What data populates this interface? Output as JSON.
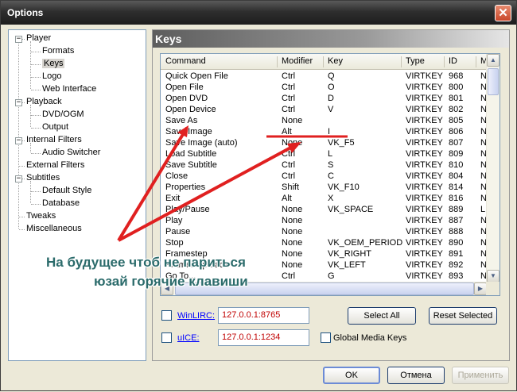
{
  "window": {
    "title": "Options",
    "close_glyph": "✕"
  },
  "tree": {
    "items": [
      {
        "label": "Player",
        "expander": "−"
      },
      {
        "label": "Formats"
      },
      {
        "label": "Keys",
        "selected": true
      },
      {
        "label": "Logo"
      },
      {
        "label": "Web Interface"
      },
      {
        "label": "Playback",
        "expander": "−"
      },
      {
        "label": "DVD/OGM"
      },
      {
        "label": "Output"
      },
      {
        "label": "Internal Filters",
        "expander": "−"
      },
      {
        "label": "Audio Switcher"
      },
      {
        "label": "External Filters"
      },
      {
        "label": "Subtitles",
        "expander": "−"
      },
      {
        "label": "Default Style"
      },
      {
        "label": "Database"
      },
      {
        "label": "Tweaks"
      },
      {
        "label": "Miscellaneous"
      }
    ]
  },
  "panel": {
    "title": "Keys"
  },
  "table": {
    "columns": [
      "Command",
      "Modifier",
      "Key",
      "Type",
      "ID",
      "M"
    ],
    "rows": [
      [
        "Quick Open File",
        "Ctrl",
        "Q",
        "VIRTKEY",
        "968",
        "N"
      ],
      [
        "Open File",
        "Ctrl",
        "O",
        "VIRTKEY",
        "800",
        "N"
      ],
      [
        "Open DVD",
        "Ctrl",
        "D",
        "VIRTKEY",
        "801",
        "N"
      ],
      [
        "Open Device",
        "Ctrl",
        "V",
        "VIRTKEY",
        "802",
        "N"
      ],
      [
        "Save As",
        "None",
        "",
        "VIRTKEY",
        "805",
        "N"
      ],
      [
        "Save Image",
        "Alt",
        "I",
        "VIRTKEY",
        "806",
        "N"
      ],
      [
        "Save Image (auto)",
        "None",
        "VK_F5",
        "VIRTKEY",
        "807",
        "N"
      ],
      [
        "Load Subtitle",
        "Ctrl",
        "L",
        "VIRTKEY",
        "809",
        "N"
      ],
      [
        "Save Subtitle",
        "Ctrl",
        "S",
        "VIRTKEY",
        "810",
        "N"
      ],
      [
        "Close",
        "Ctrl",
        "C",
        "VIRTKEY",
        "804",
        "N"
      ],
      [
        "Properties",
        "Shift",
        "VK_F10",
        "VIRTKEY",
        "814",
        "N"
      ],
      [
        "Exit",
        "Alt",
        "X",
        "VIRTKEY",
        "816",
        "N"
      ],
      [
        "Play/Pause",
        "None",
        "VK_SPACE",
        "VIRTKEY",
        "889",
        "L"
      ],
      [
        "Play",
        "None",
        "",
        "VIRTKEY",
        "887",
        "N"
      ],
      [
        "Pause",
        "None",
        "",
        "VIRTKEY",
        "888",
        "N"
      ],
      [
        "Stop",
        "None",
        "VK_OEM_PERIOD",
        "VIRTKEY",
        "890",
        "N"
      ],
      [
        "Framestep",
        "None",
        "VK_RIGHT",
        "VIRTKEY",
        "891",
        "N"
      ],
      [
        "Framestep back",
        "None",
        "VK_LEFT",
        "VIRTKEY",
        "892",
        "N"
      ],
      [
        "Go To...",
        "Ctrl",
        "G",
        "VIRTKEY",
        "893",
        "N"
      ]
    ]
  },
  "winlirc": {
    "label": "WinLIRC:",
    "value": "127.0.0.1:8765"
  },
  "uice": {
    "label": "uICE:",
    "value": "127.0.0.1:1234"
  },
  "buttons": {
    "select_all": "Select All",
    "reset_selected": "Reset Selected",
    "ok": "OK",
    "cancel": "Отмена",
    "apply": "Применить"
  },
  "global_media_keys": "Global Media Keys",
  "annotation": {
    "line1": "На будущее чтоб не париться",
    "line2": "юзай горячие клавиши",
    "color": "#e02020"
  },
  "scroll_icons": {
    "up": "▲",
    "down": "▼",
    "left": "◀",
    "right": "▶"
  }
}
